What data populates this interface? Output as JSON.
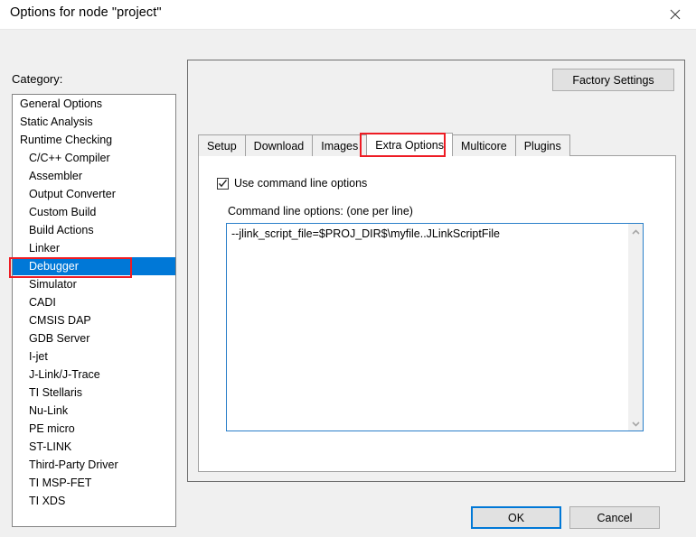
{
  "window": {
    "title": "Options for node \"project\"",
    "close_icon": "close-icon"
  },
  "sidebar": {
    "label": "Category:",
    "selected": "Debugger",
    "items": [
      {
        "label": "General Options",
        "sub": false
      },
      {
        "label": "Static Analysis",
        "sub": false
      },
      {
        "label": "Runtime Checking",
        "sub": false
      },
      {
        "label": "C/C++ Compiler",
        "sub": true
      },
      {
        "label": "Assembler",
        "sub": true
      },
      {
        "label": "Output Converter",
        "sub": true
      },
      {
        "label": "Custom Build",
        "sub": true
      },
      {
        "label": "Build Actions",
        "sub": true
      },
      {
        "label": "Linker",
        "sub": true
      },
      {
        "label": "Debugger",
        "sub": true
      },
      {
        "label": "Simulator",
        "sub": true
      },
      {
        "label": "CADI",
        "sub": true
      },
      {
        "label": "CMSIS DAP",
        "sub": true
      },
      {
        "label": "GDB Server",
        "sub": true
      },
      {
        "label": "I-jet",
        "sub": true
      },
      {
        "label": "J-Link/J-Trace",
        "sub": true
      },
      {
        "label": "TI Stellaris",
        "sub": true
      },
      {
        "label": "Nu-Link",
        "sub": true
      },
      {
        "label": "PE micro",
        "sub": true
      },
      {
        "label": "ST-LINK",
        "sub": true
      },
      {
        "label": "Third-Party Driver",
        "sub": true
      },
      {
        "label": "TI MSP-FET",
        "sub": true
      },
      {
        "label": "TI XDS",
        "sub": true
      }
    ]
  },
  "panel": {
    "factory_settings_label": "Factory Settings",
    "tabs": [
      {
        "label": "Setup",
        "active": false
      },
      {
        "label": "Download",
        "active": false
      },
      {
        "label": "Images",
        "active": false
      },
      {
        "label": "Extra Options",
        "active": true
      },
      {
        "label": "Multicore",
        "active": false
      },
      {
        "label": "Plugins",
        "active": false
      }
    ],
    "extra_options": {
      "use_command_line_label": "Use command line options",
      "use_command_line_checked": true,
      "command_line_caption": "Command line options:  (one per line)",
      "command_line_value": "--jlink_script_file=$PROJ_DIR$\\myfile..JLinkScriptFile",
      "scroll_up_icon": "chevron-up-icon",
      "scroll_down_icon": "chevron-down-icon"
    }
  },
  "footer": {
    "ok_label": "OK",
    "cancel_label": "Cancel"
  },
  "annotations": {
    "accent_color": "#ee1c24",
    "selection_color": "#0078d7",
    "focus_border_color": "#2a7fc9"
  }
}
